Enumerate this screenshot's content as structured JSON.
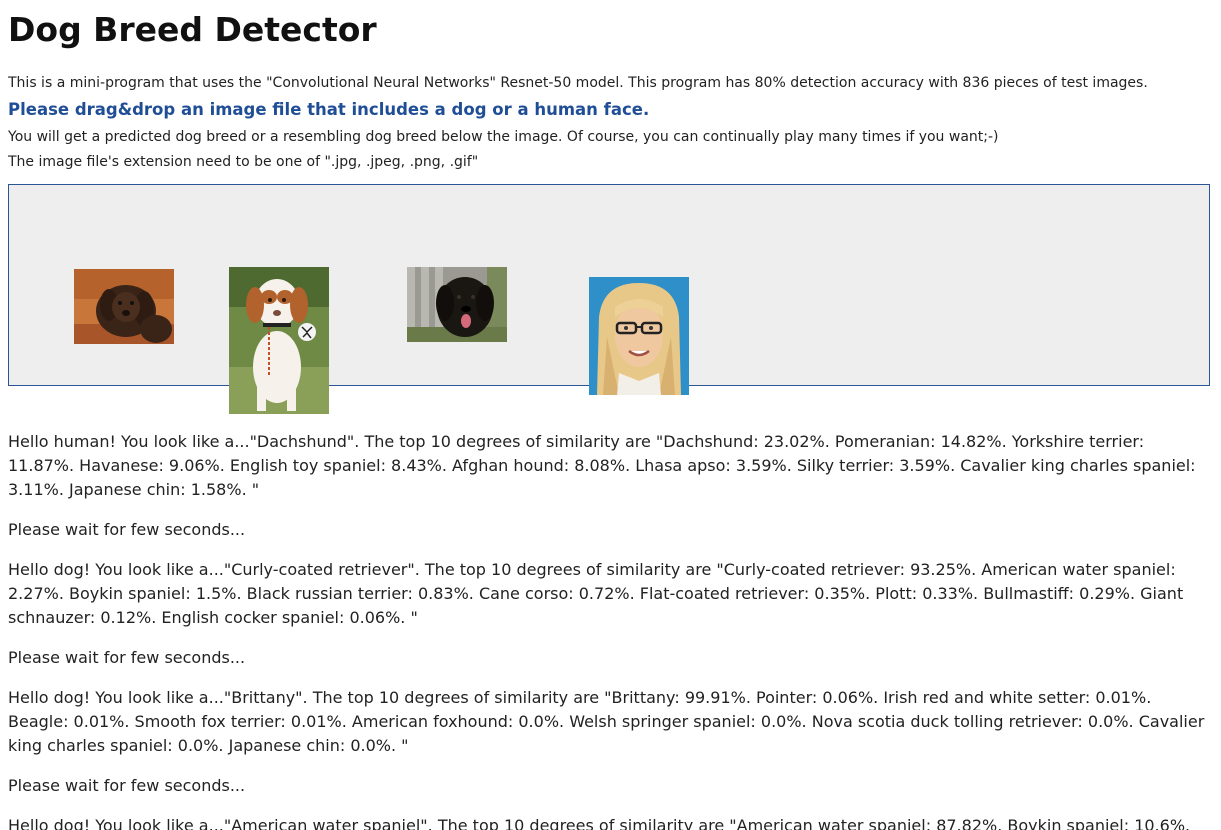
{
  "header": {
    "title": "Dog Breed Detector"
  },
  "intro": {
    "description": "This is a mini-program that uses the \"Convolutional Neural Networks\" Resnet-50 model. This program has 80% detection accuracy with 836 pieces of test images.",
    "instruction": "Please drag&drop an image file that includes a dog or a human face.",
    "note_result": "You will get a predicted dog breed or a resembling dog breed below the image. Of course, you can continually play many times if you want;-)",
    "note_extensions": "The image file's extension need to be one of \".jpg, .jpeg, .png, .gif\""
  },
  "dropzone": {
    "thumbnails": [
      {
        "icon": "curly-dog-photo"
      },
      {
        "icon": "brittany-dog-photo"
      },
      {
        "icon": "black-dog-photo"
      },
      {
        "icon": "human-face-photo"
      }
    ]
  },
  "colors": {
    "instruction": "#1f4e96",
    "dropzone_border": "#2b5594",
    "dropzone_bg": "#eeeeee"
  },
  "results": [
    "Hello human! You look like a...\"Dachshund\". The top 10 degrees of similarity are \"Dachshund: 23.02%. Pomeranian: 14.82%. Yorkshire terrier: 11.87%. Havanese: 9.06%. English toy spaniel: 8.43%. Afghan hound: 8.08%. Lhasa apso: 3.59%. Silky terrier: 3.59%. Cavalier king charles spaniel: 3.11%. Japanese chin: 1.58%. \"",
    "Please wait for few seconds...",
    "Hello dog! You look like a...\"Curly-coated retriever\". The top 10 degrees of similarity are \"Curly-coated retriever: 93.25%. American water spaniel: 2.27%. Boykin spaniel: 1.5%. Black russian terrier: 0.83%. Cane corso: 0.72%. Flat-coated retriever: 0.35%. Plott: 0.33%. Bullmastiff: 0.29%. Giant schnauzer: 0.12%. English cocker spaniel: 0.06%. \"",
    "Please wait for few seconds...",
    "Hello dog! You look like a...\"Brittany\". The top 10 degrees of similarity are \"Brittany: 99.91%. Pointer: 0.06%. Irish red and white setter: 0.01%. Beagle: 0.01%. Smooth fox terrier: 0.01%. American foxhound: 0.0%. Welsh springer spaniel: 0.0%. Nova scotia duck tolling retriever: 0.0%. Cavalier king charles spaniel: 0.0%. Japanese chin: 0.0%. \"",
    "Please wait for few seconds...",
    "Hello dog! You look like a...\"American water spaniel\". The top 10 degrees of similarity are \"American water spaniel: 87.82%. Boykin spaniel: 10.6%."
  ]
}
